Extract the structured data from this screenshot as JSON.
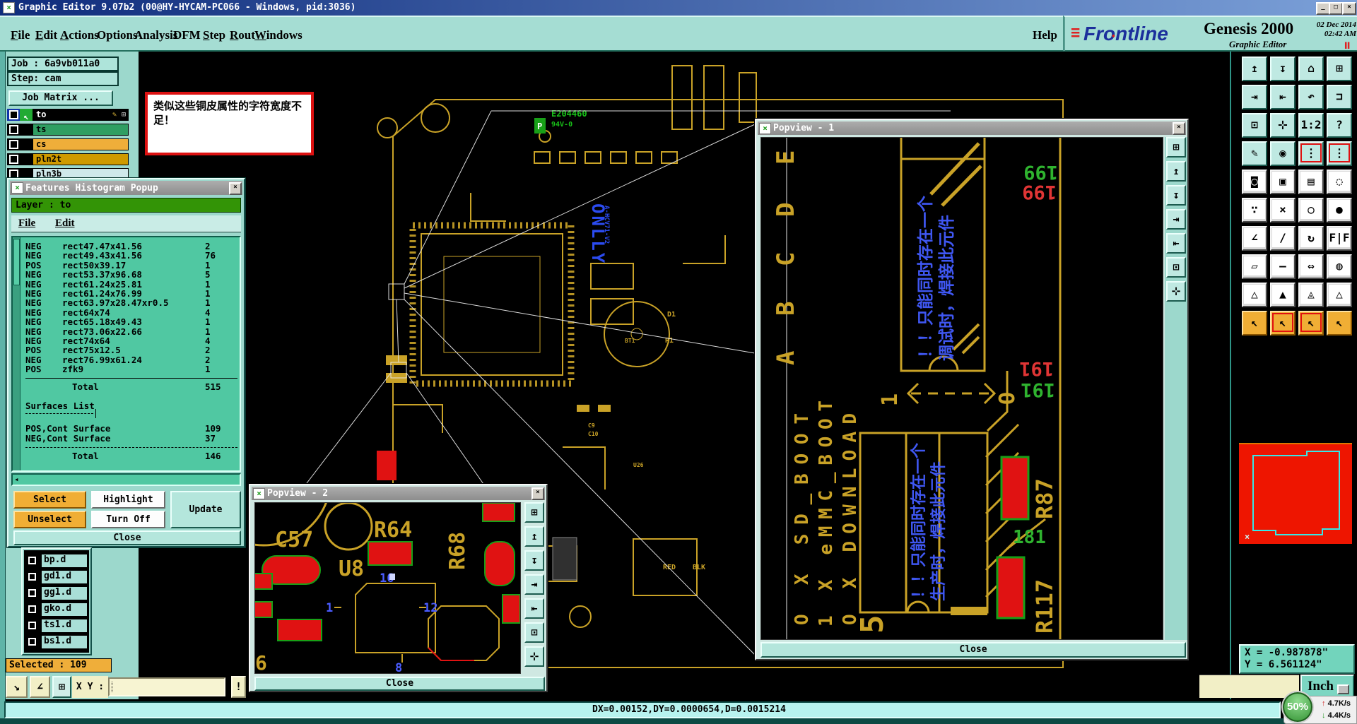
{
  "window": {
    "title": "Graphic Editor 9.07b2  (00@HY-HYCAM-PC066 - Windows, pid:3036)",
    "minimize": "_",
    "maximize": "□",
    "close": "×"
  },
  "icons": {
    "app": "×",
    "window_close": "×",
    "scroll_left": "◂",
    "dropdown": "▭",
    "pen": "✎",
    "grid": "⊞",
    "select_arrow": "↖",
    "pause": "▌▌",
    "up_arrow": "↑",
    "down_arrow": "↓",
    "resize": "↘",
    "angle_tool": "∠",
    "tile": "⊞"
  },
  "menu_bar": {
    "items": [
      {
        "label": "File",
        "hotkey": 0
      },
      {
        "label": "Edit",
        "hotkey": 0
      },
      {
        "label": "Actions",
        "hotkey": 0
      },
      {
        "label": "Options",
        "hotkey": -1
      },
      {
        "label": "Analysis",
        "hotkey": -1
      },
      {
        "label": "DFM",
        "hotkey": -1
      },
      {
        "label": "Step",
        "hotkey": 0
      },
      {
        "label": "Rout",
        "hotkey": 0
      },
      {
        "label": "Windows",
        "hotkey": 0
      }
    ],
    "help": "Help"
  },
  "banner": {
    "brand": "Frontline",
    "product": "Genesis 2000",
    "date": "02 Dec 2014",
    "time": "02:42 AM",
    "subtitle": "Graphic Editor"
  },
  "job_panel": {
    "job": "Job : 6a9vb011a0",
    "step": "Step: cam",
    "matrix_button": "Job Matrix ...",
    "layers_top": [
      {
        "label": "to",
        "bg": "#000000",
        "fg": "#ffffff",
        "selected": true
      },
      {
        "label": "ts",
        "bg": "#2f9e62",
        "fg": "#000000",
        "selected": false
      },
      {
        "label": "cs",
        "bg": "#efae3a",
        "fg": "#000000",
        "selected": false
      },
      {
        "label": "pln2t",
        "bg": "#cf9a00",
        "fg": "#000000",
        "selected": false
      },
      {
        "label": "pln3b",
        "bg": "#cfe8ea",
        "fg": "#000000",
        "selected": false
      }
    ],
    "layers_bottom": [
      "bp.d",
      "gd1.d",
      "gg1.d",
      "gko.d",
      "ts1.d",
      "bs1.d"
    ],
    "selected_label": "Selected : 109",
    "xy_label": "X Y :",
    "xy_value": "",
    "alert_button": "!"
  },
  "annotation": {
    "text": "类似这些铜皮属性的字符宽度不足！",
    "border_color": "#dd1111"
  },
  "histogram_window": {
    "title": "Features Histogram Popup",
    "layer_bar": "Layer :  to",
    "menus": [
      "File",
      "Edit"
    ],
    "rows": [
      [
        "NEG",
        "rect47.47x41.56",
        "2"
      ],
      [
        "NEG",
        "rect49.43x41.56",
        "76"
      ],
      [
        "POS",
        "rect50x39.17",
        "1"
      ],
      [
        "NEG",
        "rect53.37x96.68",
        "5"
      ],
      [
        "NEG",
        "rect61.24x25.81",
        "1"
      ],
      [
        "NEG",
        "rect61.24x76.99",
        "1"
      ],
      [
        "NEG",
        "rect63.97x28.47xr0.5",
        "1"
      ],
      [
        "NEG",
        "rect64x74",
        "4"
      ],
      [
        "NEG",
        "rect65.18x49.43",
        "1"
      ],
      [
        "NEG",
        "rect73.06x22.66",
        "1"
      ],
      [
        "NEG",
        "rect74x64",
        "4"
      ],
      [
        "POS",
        "rect75x12.5",
        "2"
      ],
      [
        "NEG",
        "rect76.99x61.24",
        "2"
      ],
      [
        "POS",
        "zfk9",
        "1"
      ]
    ],
    "total_label": "Total",
    "total_value": "515",
    "surfaces_heading": "Surfaces List",
    "surface_rows": [
      [
        "POS,Cont Surface",
        "109"
      ],
      [
        "NEG,Cont Surface",
        "37"
      ]
    ],
    "surfaces_total_label": "Total",
    "surfaces_total_value": "146",
    "buttons": {
      "select": "Select",
      "highlight": "Highlight",
      "update": "Update",
      "unselect": "Unselect",
      "turn_off": "Turn Off",
      "close": "Close"
    }
  },
  "popview1": {
    "title": "Popview - 1",
    "close": "Close",
    "labels": {
      "letters": [
        "E",
        "D",
        "C",
        "B",
        "A"
      ],
      "boot1": "O X SD_BOOT",
      "boot2": "1 X eMMC_BOOT",
      "boot3": "O X DOWNLOAD",
      "jumper_left": "1",
      "jumper_right": "O",
      "note_top1": "！！只能同时存在一个",
      "note_top2": "调试时，焊接此元件",
      "note_bot1": "！！只能同时存在一个",
      "note_bot2": "生产时，焊接此元件",
      "n199": "199",
      "n191": "191",
      "n181": "181",
      "r87": "R87",
      "r117": "R117",
      "five": "5"
    }
  },
  "popview2": {
    "title": "Popview - 2",
    "close": "Close",
    "labels": {
      "c57": "C57",
      "r64": "R64",
      "r68": "R68",
      "u8": "U8",
      "pin16": "16",
      "pin1": "1",
      "pin12": "12",
      "pin8": "8",
      "six": "6"
    }
  },
  "popview_toolbar": [
    {
      "name": "detach-view-icon",
      "glyph": "⊞"
    },
    {
      "name": "clipboard-in-icon",
      "glyph": "↥"
    },
    {
      "name": "clipboard-out-icon",
      "glyph": "↧"
    },
    {
      "name": "pan-in-icon",
      "glyph": "⇥"
    },
    {
      "name": "pan-out-icon",
      "glyph": "⇤"
    },
    {
      "name": "fit-view-icon",
      "glyph": "⊡"
    },
    {
      "name": "center-view-icon",
      "glyph": "⊹"
    }
  ],
  "right_toolbar": {
    "rows": [
      {
        "style": "teal",
        "buttons": [
          {
            "name": "clipboard-in-button",
            "glyph": "↥"
          },
          {
            "name": "clipboard-out-button",
            "glyph": "↧"
          },
          {
            "name": "home-view-button",
            "glyph": "⌂"
          },
          {
            "name": "window-xy-button",
            "glyph": "⊞"
          }
        ]
      },
      {
        "style": "teal",
        "buttons": [
          {
            "name": "pan-in-button",
            "glyph": "⇥"
          },
          {
            "name": "pan-out-button",
            "glyph": "⇤"
          },
          {
            "name": "undo-view-button",
            "glyph": "↶"
          },
          {
            "name": "redo-view-button",
            "glyph": "⊐"
          }
        ]
      },
      {
        "style": "teal",
        "buttons": [
          {
            "name": "fit-window-button",
            "glyph": "⊡"
          },
          {
            "name": "center-view-button",
            "glyph": "⊹"
          },
          {
            "name": "scale-1-2-button",
            "glyph": "1:2"
          },
          {
            "name": "help-query-button",
            "glyph": "?"
          }
        ]
      },
      {
        "style": "teal",
        "buttons": [
          {
            "name": "setup-tools-button",
            "glyph": "✎"
          },
          {
            "name": "net-node-button",
            "glyph": "◉"
          },
          {
            "name": "layer-stackup-a-button",
            "glyph": "⋮",
            "red": true
          },
          {
            "name": "layer-stackup-b-button",
            "glyph": "⋮",
            "red": true
          }
        ]
      },
      {
        "style": "grey",
        "buttons": [
          {
            "name": "select-feature-button",
            "glyph": "◙"
          },
          {
            "name": "zoom-area-button",
            "glyph": "▣"
          },
          {
            "name": "ruler-button",
            "glyph": "▤"
          },
          {
            "name": "select-region-button",
            "glyph": "◌"
          }
        ]
      },
      {
        "style": "grey",
        "buttons": [
          {
            "name": "net-chain-button",
            "glyph": "∵"
          },
          {
            "name": "net-delete-button",
            "glyph": "×"
          },
          {
            "name": "probe-open-button",
            "glyph": "○"
          },
          {
            "name": "probe-filled-button",
            "glyph": "●"
          }
        ]
      },
      {
        "style": "grey",
        "buttons": [
          {
            "name": "angle-measure-button",
            "glyph": "∠"
          },
          {
            "name": "line-measure-button",
            "glyph": "/"
          },
          {
            "name": "rotate-button",
            "glyph": "↻"
          },
          {
            "name": "mirror-button",
            "glyph": "F|F"
          }
        ]
      },
      {
        "style": "grey",
        "buttons": [
          {
            "name": "copy-shape-button",
            "glyph": "▱"
          },
          {
            "name": "flatten-button",
            "glyph": "—"
          },
          {
            "name": "distance-button",
            "glyph": "⇔"
          },
          {
            "name": "merge-shapes-button",
            "glyph": "◍"
          }
        ]
      },
      {
        "style": "grey",
        "buttons": [
          {
            "name": "marker-up-button",
            "glyph": "△"
          },
          {
            "name": "marker-filled-button",
            "glyph": "▲"
          },
          {
            "name": "marker-base-button",
            "glyph": "◬"
          },
          {
            "name": "marker-cross-button",
            "glyph": "△"
          }
        ]
      },
      {
        "style": "orange",
        "buttons": [
          {
            "name": "cursor-plain-button",
            "glyph": "↖"
          },
          {
            "name": "cursor-frame-button",
            "glyph": "↖",
            "red": true
          },
          {
            "name": "cursor-round-button",
            "glyph": "↖",
            "red": true
          },
          {
            "name": "cursor-net-button",
            "glyph": "↖"
          }
        ]
      }
    ]
  },
  "navigator": {
    "marker": "×"
  },
  "coords_panel": {
    "x": "X = -0.987878\"",
    "y": "Y = 6.561124\""
  },
  "units_button": {
    "label": "Inch"
  },
  "zoom_badge": "50%",
  "net_speed": {
    "up": "4.7K/s",
    "down": "4.4K/s"
  },
  "status_bar": {
    "text": "DX=0.00152,DY=0.0000654,D=0.0015214"
  },
  "canvas_labels": {
    "part_no": "E204460",
    "cert": "94V-0",
    "logo": "P",
    "brand": "ONLLY",
    "model": "A-HCV71-V2",
    "red": "RED",
    "blk": "BLK",
    "d1": "D1",
    "bt1": "BT1",
    "r1": "R1",
    "c9": "C9",
    "c10": "C10",
    "u26": "U26"
  }
}
